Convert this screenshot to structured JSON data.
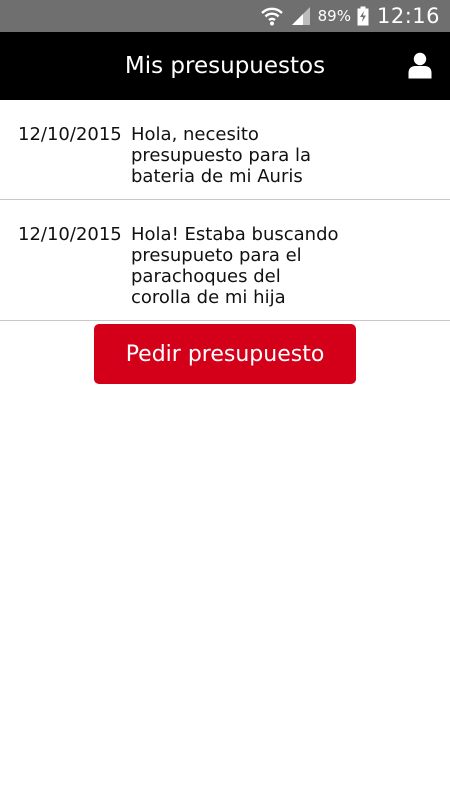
{
  "status_bar": {
    "battery_percent": "89%",
    "time": "12:16",
    "icons": [
      "wifi-icon",
      "signal-icon",
      "battery-charging-icon"
    ]
  },
  "app_bar": {
    "title": "Mis presupuestos",
    "profile_icon": "user-icon"
  },
  "quotes": [
    {
      "date": "12/10/2015",
      "message": "Hola, necesito presupuesto para la bateria de mi Auris"
    },
    {
      "date": "12/10/2015",
      "message": "Hola! Estaba buscando presupueto para el parachoques del corolla de mi hija"
    }
  ],
  "actions": {
    "request_quote_label": "Pedir presupuesto"
  },
  "colors": {
    "status_bar": "#6f6f6f",
    "app_bar": "#000000",
    "accent": "#d4001a",
    "divider": "#c8c8c8"
  }
}
